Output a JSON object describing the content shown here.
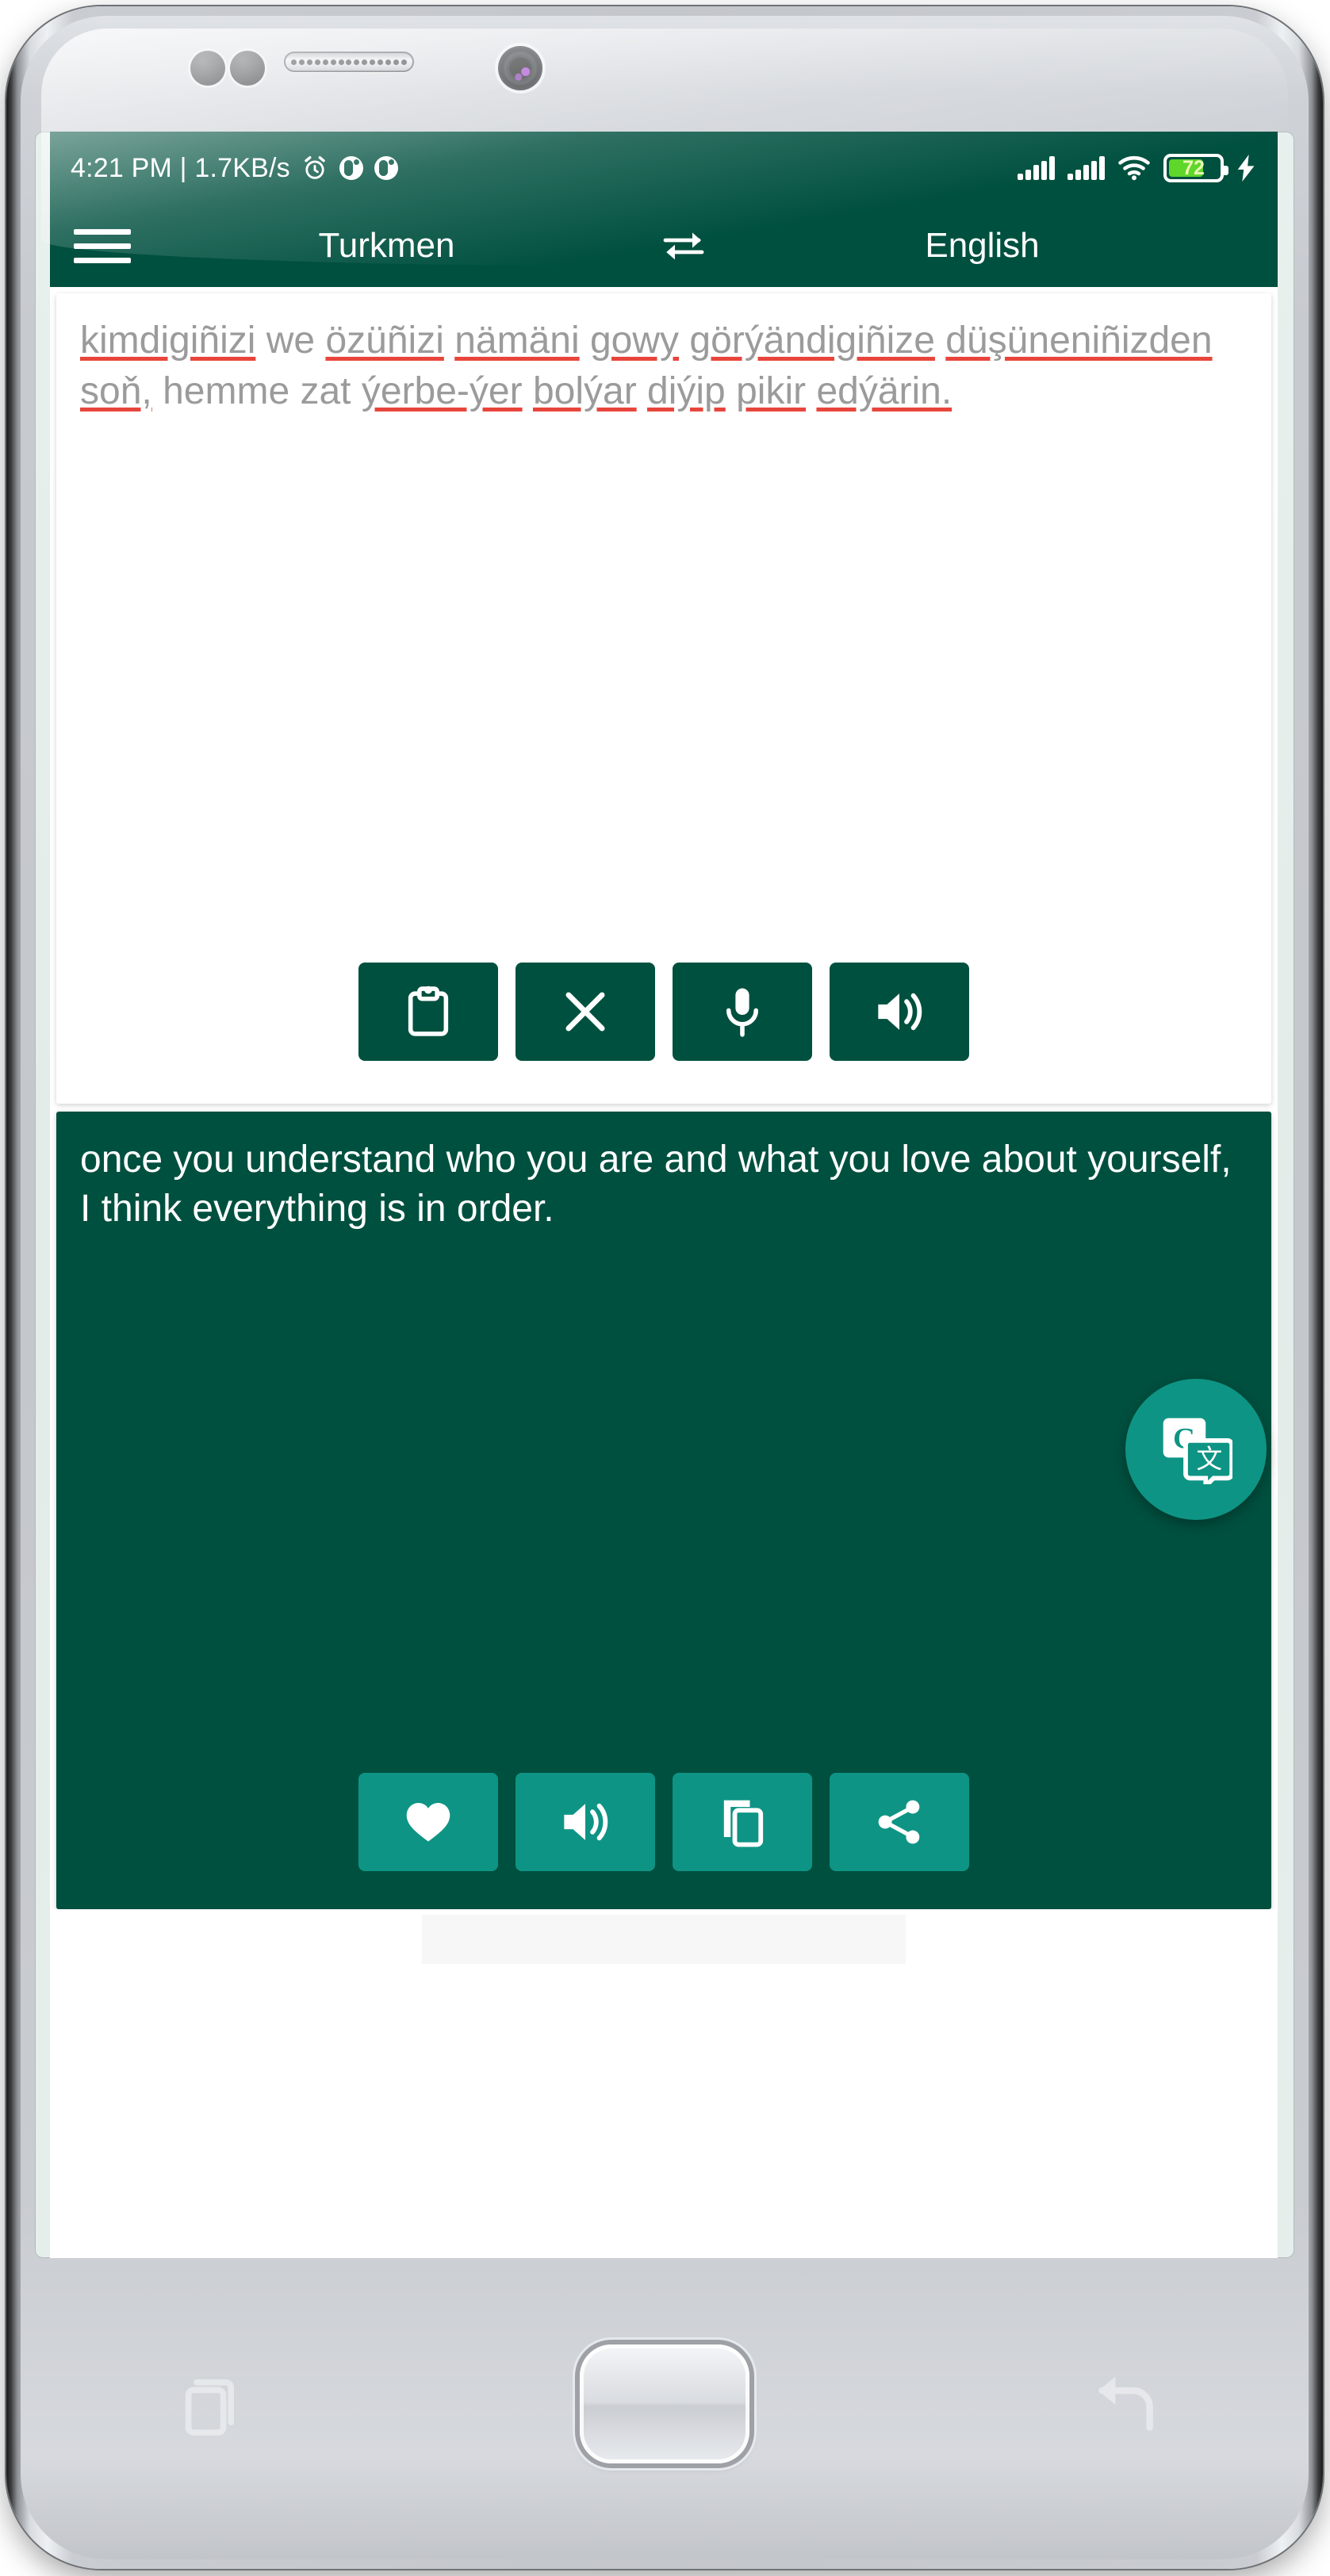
{
  "status_bar": {
    "time_and_speed": "4:21 PM | 1.7KB/s",
    "battery_percent": "72",
    "icons": [
      "alarm-icon",
      "do-not-disturb-icon",
      "data-saver-icon",
      "signal-bars-icon",
      "signal-bars-icon",
      "wifi-icon",
      "battery-icon",
      "charging-bolt-icon"
    ]
  },
  "app_bar": {
    "menu_icon": "hamburger-menu-icon",
    "source_language": "Turkmen",
    "swap_icon": "swap-languages-icon",
    "target_language": "English"
  },
  "source": {
    "text": "kimdigiñizi we özüñizi nämäni gowy görýändigiñize düşüneniñizden soň, hemme zat ýerbe-ýer bolýar diýip pikir edýärin.",
    "tokens": [
      {
        "t": "kimdigiñizi",
        "spell": true
      },
      {
        "t": "we",
        "spell": false
      },
      {
        "t": "özüñizi",
        "spell": true
      },
      {
        "t": "nämäni",
        "spell": true
      },
      {
        "t": "gowy",
        "spell": true
      },
      {
        "t": "görýändigiñize",
        "spell": true
      },
      {
        "t": "düşüneniñizden",
        "spell": true
      },
      {
        "t": "soň,",
        "spell": true
      },
      {
        "t": "hemme",
        "spell": false
      },
      {
        "t": "zat",
        "spell": false
      },
      {
        "t": "ýerbe-ýer",
        "spell": true
      },
      {
        "t": "bolýar",
        "spell": true
      },
      {
        "t": "diýip",
        "spell": true
      },
      {
        "t": "pikir",
        "spell": true
      },
      {
        "t": "edýärin.",
        "spell": true
      }
    ],
    "actions": [
      {
        "name": "paste-button",
        "icon": "clipboard-paste-icon",
        "label": "Paste"
      },
      {
        "name": "clear-button",
        "icon": "close-x-icon",
        "label": "Clear"
      },
      {
        "name": "voice-input-button",
        "icon": "microphone-icon",
        "label": "Speak"
      },
      {
        "name": "speak-source-button",
        "icon": "speaker-icon",
        "label": "Listen"
      }
    ]
  },
  "fab": {
    "icon": "google-translate-icon",
    "label": "Translate"
  },
  "target": {
    "text": "once you understand who you are and what you love about yourself, I think everything is in order.",
    "actions": [
      {
        "name": "favorite-button",
        "icon": "heart-icon",
        "label": "Favorite"
      },
      {
        "name": "speak-target-button",
        "icon": "speaker-icon",
        "label": "Listen"
      },
      {
        "name": "copy-button",
        "icon": "copy-icon",
        "label": "Copy"
      },
      {
        "name": "share-button",
        "icon": "share-icon",
        "label": "Share"
      }
    ]
  },
  "device_nav": {
    "recents_icon": "recents-overview-icon",
    "home_button": "home-button",
    "back_icon": "back-arrow-icon"
  },
  "colors": {
    "primary_dark_green": "#00503F",
    "accent_teal": "#0E9484",
    "spell_underline_red": "#E8453C",
    "battery_green": "#5FD62A",
    "source_text_gray": "#9B9B9B"
  }
}
